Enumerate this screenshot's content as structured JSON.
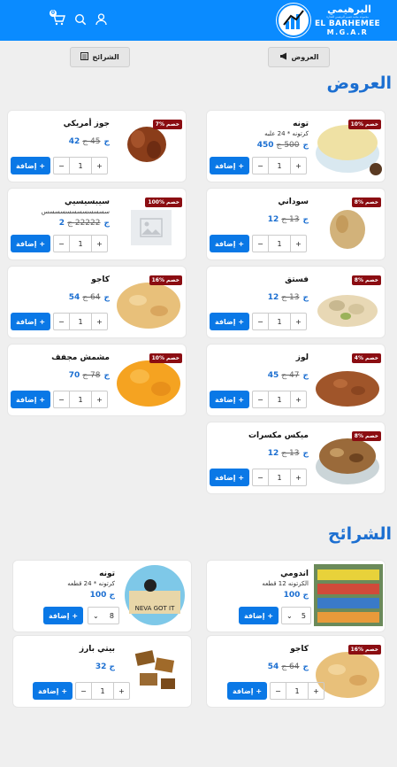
{
  "header": {
    "logo_ar": "البرهيمي",
    "logo_tagline": "مجموعة محمد قسيم البرهيمي للتجارة",
    "logo_en": "EL BARHEMEE",
    "logo_en2": "M.G.A.R",
    "cart_count": "0",
    "icons": [
      "user-icon",
      "search-icon",
      "cart-icon"
    ]
  },
  "nav": {
    "offers_label": "العروض",
    "slices_label": "الشرائح"
  },
  "sections": {
    "offers_title": "العروض",
    "slices_title": "الشرائح"
  },
  "offers": [
    {
      "name": "تونه",
      "desc": "كرتونه * 24 علبه",
      "price": "450 ج",
      "old": "500 ج",
      "badge": "خصم %10",
      "qty": "1",
      "add": "إضافة +"
    },
    {
      "name": "جوز أمريكي",
      "desc": "",
      "price": "42 ج",
      "old": "45 ج",
      "badge": "خصم %7",
      "qty": "1",
      "add": "إضافة +"
    },
    {
      "name": "سوداني",
      "desc": "",
      "price": "12 ج",
      "old": "13 ج",
      "badge": "خصم %8",
      "qty": "1",
      "add": "إضافة +"
    },
    {
      "name": "سيبسيسيي",
      "desc": "سسسسسسسسسسسس",
      "price": "2 ج",
      "old": "22222 ج",
      "badge": "خصم %100",
      "qty": "1",
      "add": "إضافة +"
    },
    {
      "name": "فستق",
      "desc": "",
      "price": "12 ج",
      "old": "13 ج",
      "badge": "خصم %8",
      "qty": "1",
      "add": "إضافة +"
    },
    {
      "name": "كاجو",
      "desc": "",
      "price": "54 ج",
      "old": "64 ج",
      "badge": "خصم %16",
      "qty": "1",
      "add": "إضافة +"
    },
    {
      "name": "لوز",
      "desc": "",
      "price": "45 ج",
      "old": "47 ج",
      "badge": "خصم %4",
      "qty": "1",
      "add": "إضافة +"
    },
    {
      "name": "مشمش مجفف",
      "desc": "",
      "price": "70 ج",
      "old": "78 ج",
      "badge": "خصم %10",
      "qty": "1",
      "add": "إضافة +"
    },
    {
      "name": "ميكس مكسرات",
      "desc": "",
      "price": "12 ج",
      "old": "13 ج",
      "badge": "خصم %8",
      "qty": "1",
      "add": "إضافة +"
    }
  ],
  "slices": [
    {
      "name": "اندومي",
      "desc": "الكرتونه 12 قطعه",
      "price": "100 ج",
      "select": "5",
      "add": "إضافة +"
    },
    {
      "name": "تونه",
      "desc": "كرتونه * 24 قطعه",
      "price": "100 ج",
      "select": "8",
      "add": "إضافة +"
    },
    {
      "name": "كاجو",
      "desc": "",
      "price": "54 ج",
      "old": "64 ج",
      "badge": "خصم %16",
      "qty": "1",
      "add": "إضافة +"
    },
    {
      "name": "بيتي بارز",
      "desc": "",
      "price": "32 ج",
      "qty": "1",
      "add": "إضافة +"
    }
  ],
  "colors": {
    "primary": "#0a8bff",
    "accent": "#1c6fd1",
    "badge": "#8b0d12"
  }
}
